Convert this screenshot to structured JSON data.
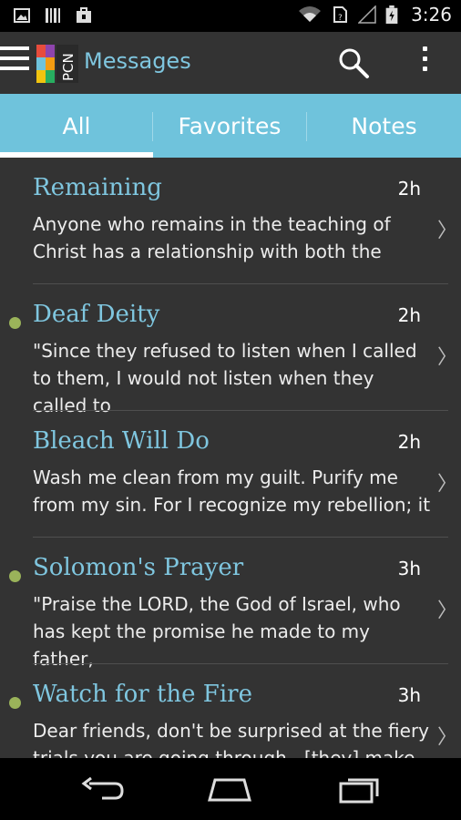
{
  "status_bar": {
    "time": "3:26",
    "icons": [
      "image-icon",
      "barcode-icon",
      "briefcase-icon",
      "wifi-icon",
      "sim-icon",
      "signal-icon",
      "battery-icon"
    ]
  },
  "action_bar": {
    "title": "Messages",
    "logo_text": "PCN",
    "accent_color": "#7fc6df"
  },
  "tabs": [
    {
      "label": "All",
      "active": true
    },
    {
      "label": "Favorites",
      "active": false
    },
    {
      "label": "Notes",
      "active": false
    }
  ],
  "messages": [
    {
      "title": "Remaining",
      "time": "2h",
      "unread": false,
      "excerpt": "Anyone who remains in the teaching of Christ has a relationship with both the"
    },
    {
      "title": "Deaf Deity",
      "time": "2h",
      "unread": true,
      "excerpt": "\"Since they refused to listen when I called to them, I would not listen when they called to"
    },
    {
      "title": "Bleach Will Do",
      "time": "2h",
      "unread": false,
      "excerpt": "Wash me clean from my guilt. Purify me from my sin. For I recognize my rebellion; it"
    },
    {
      "title": "Solomon's Prayer",
      "time": "3h",
      "unread": true,
      "excerpt": "\"Praise the LORD, the God of Israel, who has kept the promise he made to my father,"
    },
    {
      "title": "Watch for the Fire",
      "time": "3h",
      "unread": true,
      "excerpt": "Dear friends, don't be surprised at the fiery trials you are going through...[they] make"
    }
  ],
  "colors": {
    "tab_bar": "#6fc3dc",
    "list_bg": "#333333",
    "unread_dot": "#9ab35a"
  },
  "chevron": "〉"
}
